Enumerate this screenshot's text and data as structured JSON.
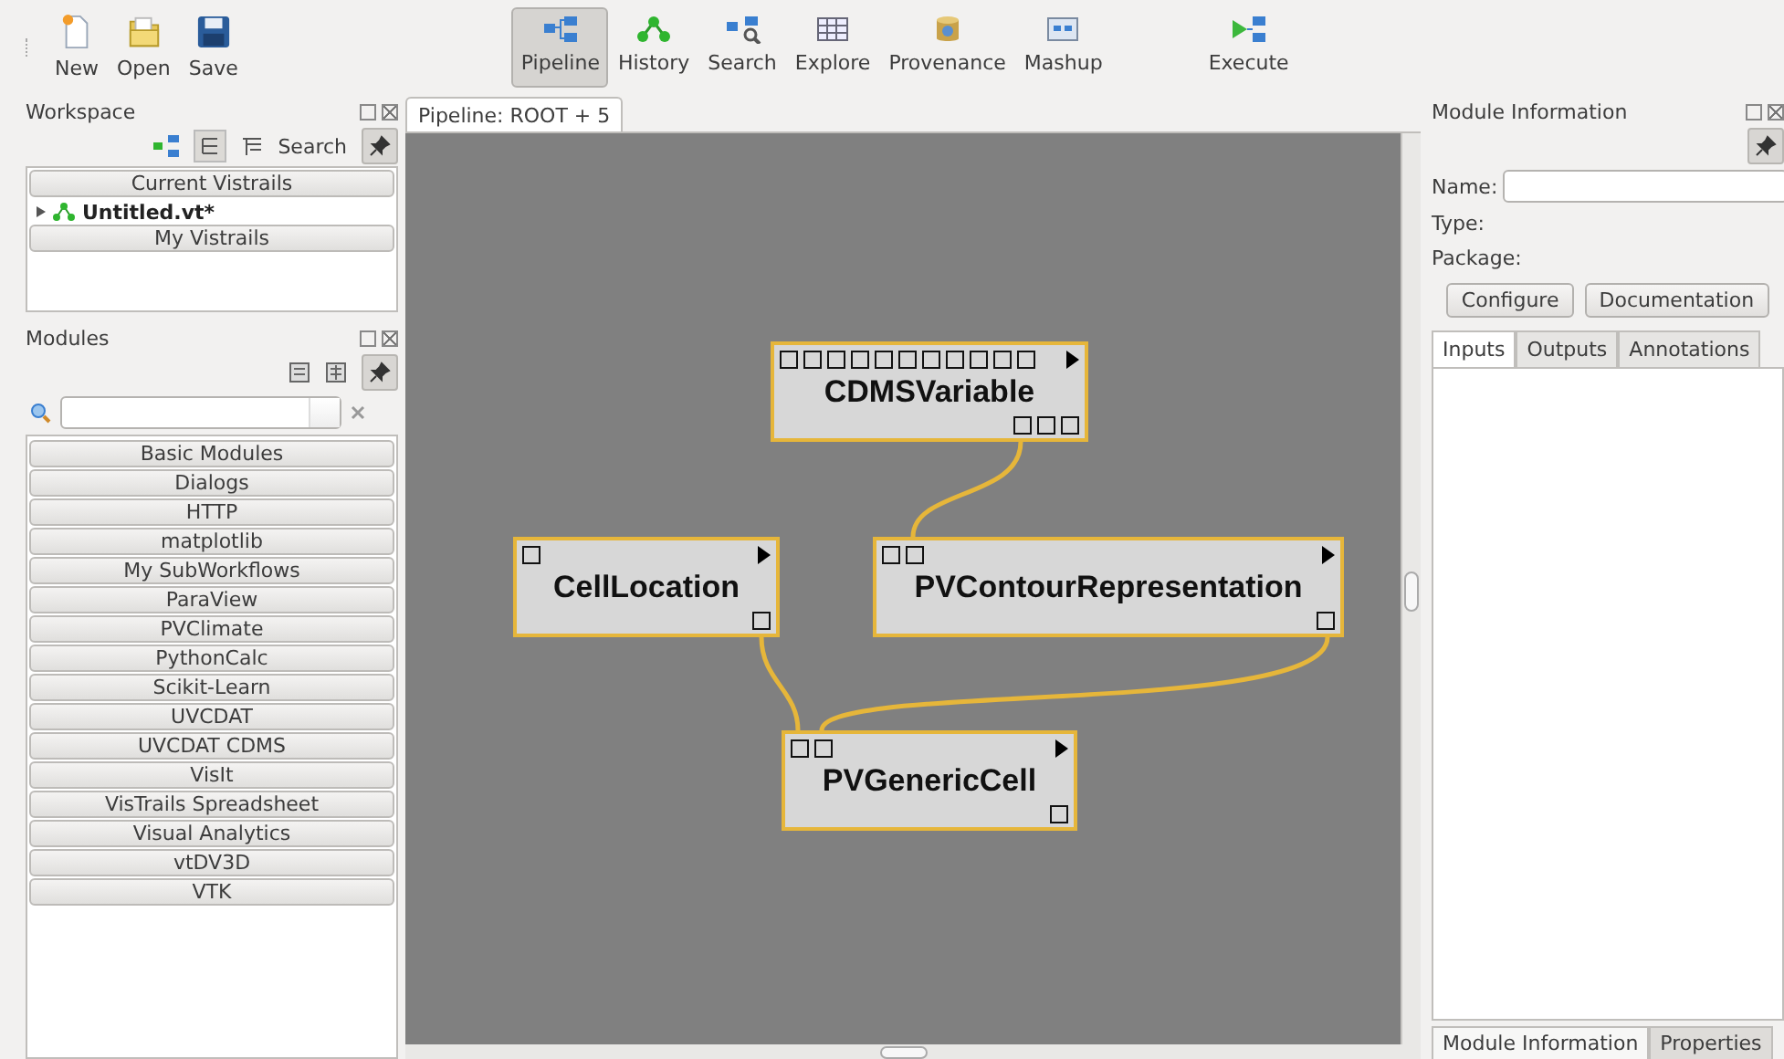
{
  "toolbar": {
    "file_actions": [
      {
        "label": "New",
        "kind": "new"
      },
      {
        "label": "Open",
        "kind": "open"
      },
      {
        "label": "Save",
        "kind": "save"
      }
    ],
    "views": [
      {
        "label": "Pipeline",
        "kind": "pipeline",
        "selected": true
      },
      {
        "label": "History",
        "kind": "history",
        "selected": false
      },
      {
        "label": "Search",
        "kind": "search",
        "selected": false
      },
      {
        "label": "Explore",
        "kind": "explore",
        "selected": false
      },
      {
        "label": "Provenance",
        "kind": "provenance",
        "selected": false
      },
      {
        "label": "Mashup",
        "kind": "mashup",
        "selected": false
      }
    ],
    "execute": {
      "label": "Execute"
    }
  },
  "workspace": {
    "title": "Workspace",
    "search_label": "Search",
    "sections": [
      {
        "title": "Current Vistrails",
        "items": [
          {
            "label": "Untitled.vt*",
            "expanded": false
          }
        ]
      },
      {
        "title": "My Vistrails"
      }
    ]
  },
  "modules": {
    "title": "Modules",
    "packages": [
      "Basic Modules",
      "Dialogs",
      "HTTP",
      "matplotlib",
      "My SubWorkflows",
      "ParaView",
      "PVClimate",
      "PythonCalc",
      "Scikit-Learn",
      "UVCDAT",
      "UVCDAT CDMS",
      "VisIt",
      "VisTrails Spreadsheet",
      "Visual Analytics",
      "vtDV3D",
      "VTK"
    ]
  },
  "pipeline": {
    "tab": "Pipeline: ROOT + 5",
    "nodes": [
      {
        "name": "CDMSVariable"
      },
      {
        "name": "CellLocation"
      },
      {
        "name": "PVContourRepresentation"
      },
      {
        "name": "PVGenericCell"
      }
    ]
  },
  "module_information": {
    "title": "Module Information",
    "name_label": "Name:",
    "type_label": "Type:",
    "package_label": "Package:",
    "buttons": [
      "Configure",
      "Documentation"
    ],
    "tabs": [
      {
        "label": "Inputs",
        "selected": true
      },
      {
        "label": "Outputs",
        "selected": false
      },
      {
        "label": "Annotations",
        "selected": false
      }
    ],
    "bottom_tabs": [
      {
        "label": "Module Information",
        "selected": true
      },
      {
        "label": "Properties",
        "selected": false
      }
    ]
  }
}
